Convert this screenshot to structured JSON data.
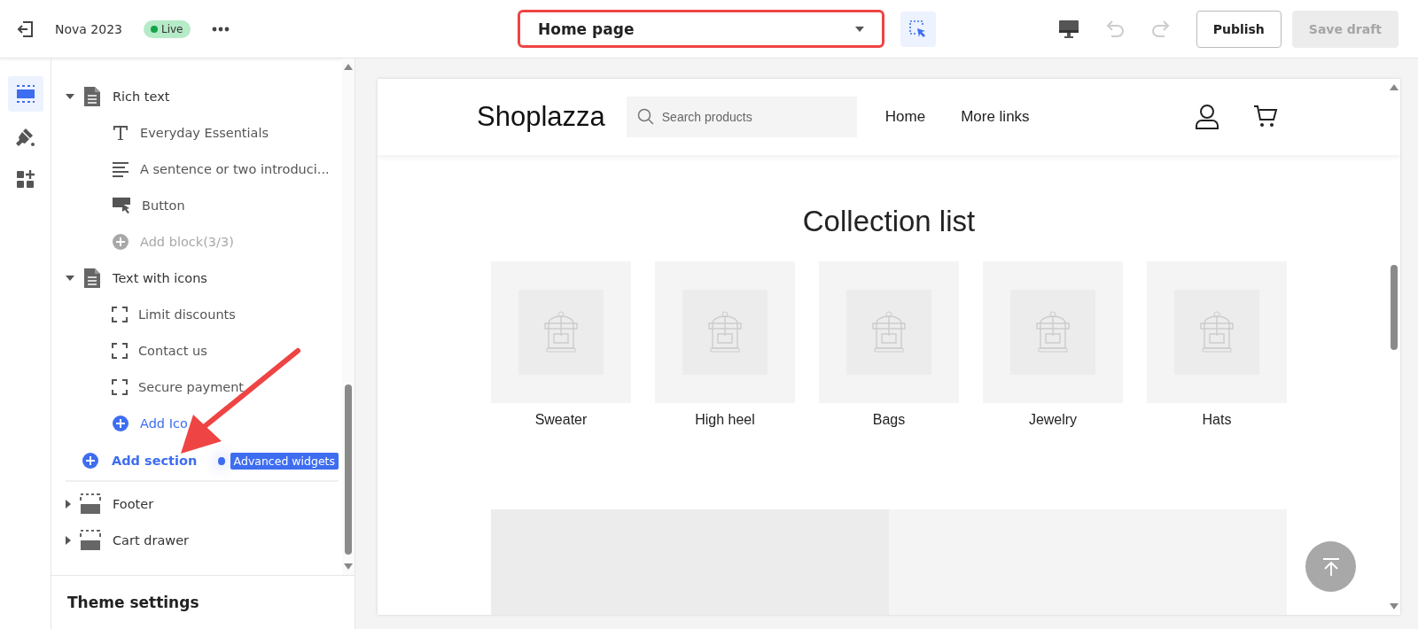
{
  "topbar": {
    "theme_name": "Nova 2023",
    "status": "Live",
    "page_select": {
      "value": "Home page",
      "highlighted": true
    },
    "publish": "Publish",
    "save_draft": {
      "label": "Save draft",
      "disabled": true
    }
  },
  "rail": [
    {
      "kind": "sections",
      "selected": true
    },
    {
      "kind": "theme",
      "selected": false
    },
    {
      "kind": "apps",
      "selected": false
    }
  ],
  "tree": [
    {
      "kind": "doc",
      "title": "Rich text",
      "expanded": true,
      "children": [
        {
          "kind": "heading",
          "label": "Everyday Essentials"
        },
        {
          "kind": "paragraph",
          "label": "A sentence or two introduci..."
        },
        {
          "kind": "button",
          "label": "Button"
        },
        {
          "kind": "add",
          "label": "Add block(3/3)",
          "disabled": true
        }
      ]
    },
    {
      "kind": "doc",
      "title": "Text with icons",
      "expanded": true,
      "children": [
        {
          "kind": "icon",
          "label": "Limit discounts"
        },
        {
          "kind": "icon",
          "label": "Contact us"
        },
        {
          "kind": "icon",
          "label": "Secure payment"
        },
        {
          "kind": "add",
          "label": "Add Ico",
          "disabled": false
        }
      ]
    }
  ],
  "add_section": {
    "label": "Add section",
    "badge": "Advanced widgets"
  },
  "bottom_sections": [
    {
      "kind": "layout",
      "title": "Footer",
      "expanded": false
    },
    {
      "kind": "layout",
      "title": "Cart drawer",
      "expanded": false
    }
  ],
  "theme_settings": "Theme settings",
  "preview": {
    "logo": "Shoplazza",
    "search": {
      "placeholder": "Search products"
    },
    "nav": [
      "Home",
      "More links"
    ],
    "collection_title": "Collection list",
    "collections": [
      "Sweater",
      "High heel",
      "Bags",
      "Jewelry",
      "Hats"
    ]
  }
}
